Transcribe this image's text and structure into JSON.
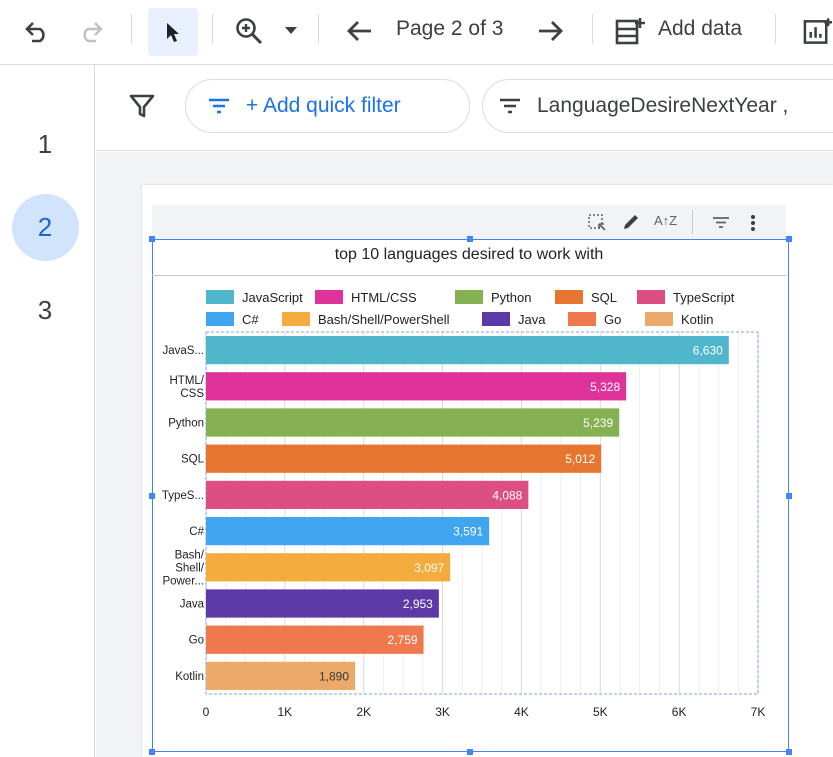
{
  "toolbar": {
    "page_indicator": "Page 2 of 3",
    "add_data_label": "Add data"
  },
  "pages": {
    "items": [
      "1",
      "2",
      "3"
    ],
    "active": "2"
  },
  "filters": {
    "add_quick_filter": "+ Add quick filter",
    "active_filter": "LanguageDesireNextYear ,"
  },
  "colors": {
    "accent": "#1a73e8",
    "selection": "#4285f4"
  },
  "chart_data": {
    "type": "bar",
    "orientation": "horizontal",
    "title": "top 10 languages desired to work with",
    "categories": [
      "JavaScript",
      "HTML/CSS",
      "Python",
      "SQL",
      "TypeScript",
      "C#",
      "Bash/Shell/PowerShell",
      "Java",
      "Go",
      "Kotlin"
    ],
    "tick_categories": [
      "JavaS...",
      "HTML/ CSS",
      "Python",
      "SQL",
      "TypeS...",
      "C#",
      "Bash/ Shell/ Power...",
      "Java",
      "Go",
      "Kotlin"
    ],
    "values": [
      6630,
      5328,
      5239,
      5012,
      4088,
      3591,
      3097,
      2953,
      2759,
      1890
    ],
    "value_labels": [
      "6,630",
      "5,328",
      "5,239",
      "5,012",
      "4,088",
      "3,591",
      "3,097",
      "2,953",
      "2,759",
      "1,890"
    ],
    "colors": [
      "#4fb6cb",
      "#e0339a",
      "#86b153",
      "#e6762f",
      "#dc4f80",
      "#3fa5ef",
      "#f4ac3c",
      "#5b3aa8",
      "#f0784f",
      "#eda96a"
    ],
    "x_ticks": [
      "0",
      "1K",
      "2K",
      "3K",
      "4K",
      "5K",
      "6K",
      "7K"
    ],
    "xlim": [
      0,
      7000
    ],
    "grid": true,
    "legend_position": "top"
  }
}
